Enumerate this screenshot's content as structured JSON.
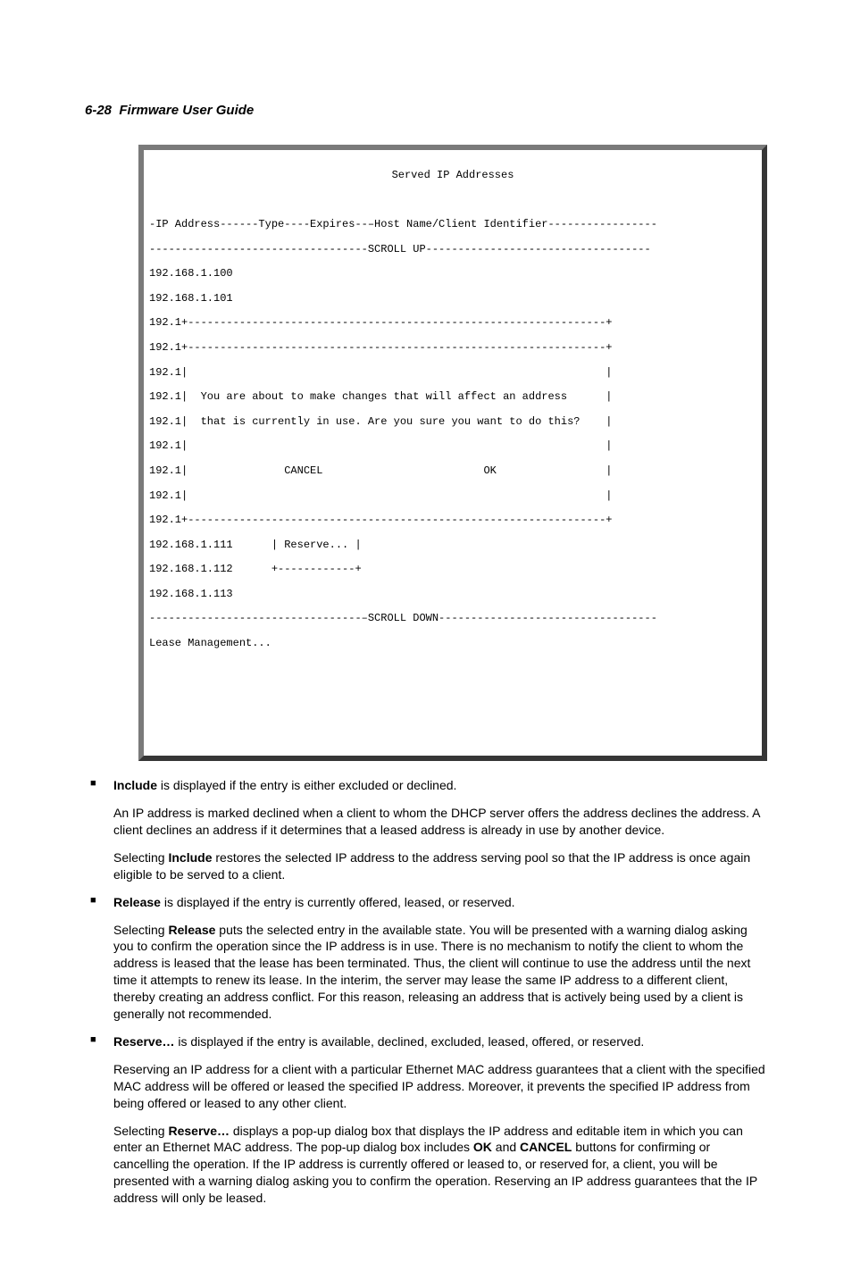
{
  "header": {
    "page_number": "6-28",
    "title": "Firmware User Guide"
  },
  "terminal": {
    "title": "Served IP Addresses",
    "columns_line": "-IP Address------Type----Expires--–Host Name/Client Identifier-----------------",
    "scroll_up_line": "----------------------------------SCROLL UP-----------------------------------",
    "ips_top": [
      "192.168.1.100",
      "192.168.1.101"
    ],
    "box_border_top1": "192.1+-----------------------------------------------------------------+",
    "box_border_top2": "192.1+-----------------------------------------------------------------+",
    "box_empty": "192.1|                                                                 |",
    "box_msg1": "192.1|  You are about to make changes that will affect an address      |",
    "box_msg2": "192.1|  that is currently in use. Are you sure you want to do this?    |",
    "box_empty2": "192.1|                                                                 |",
    "box_buttons": "192.1|               CANCEL                         OK                 |",
    "box_empty3": "192.1|                                                                 |",
    "box_border_bot": "192.1+-----------------------------------------------------------------+",
    "ip_reserve": "192.168.1.111      | Reserve... |",
    "ip_112": "192.168.1.112      +------------+",
    "ip_113": "192.168.1.113",
    "scroll_down_line": "---------------------------------–SCROLL DOWN----------------------------------",
    "lease_mgmt": "Lease Management..."
  },
  "bullets": [
    {
      "lead": "Include",
      "lead_rest": " is displayed if the entry is either excluded or declined.",
      "paras": [
        "An IP address is marked declined when a client to whom the DHCP server offers the address declines the address. A client declines an address if it determines that a leased address is already in use by another device.",
        {
          "pre": "Selecting ",
          "bold": "Include",
          "post": " restores the selected IP address to the address serving pool so that the IP address is once again eligible to be served to a client."
        }
      ]
    },
    {
      "lead": "Release",
      "lead_rest": " is displayed if the entry is currently offered, leased, or reserved.",
      "paras": [
        {
          "pre": "Selecting ",
          "bold": "Release",
          "post": " puts the selected entry in the available state. You will be presented with a warning dialog asking you to confirm the operation since the IP address is in use. There is no mechanism to notify the client to whom the address is leased that the lease has been terminated. Thus, the client will continue to use the address until the next time it attempts to renew its lease. In the interim, the server may lease the same IP address to a different client, thereby creating an address conflict. For this reason, releasing an address that is actively being used by a client is generally not recommended."
        }
      ]
    },
    {
      "lead": "Reserve…",
      "lead_rest": " is displayed if the entry is available, declined, excluded, leased, offered, or reserved.",
      "paras": [
        "Reserving an IP address for a client with a particular Ethernet MAC address guarantees that a client with the specified MAC address will be offered or leased the specified IP address. Moreover, it prevents the specified IP address from being offered or leased to any other client.",
        {
          "pre": "Selecting ",
          "bold": "Reserve…",
          "post": " displays a pop-up dialog box that displays the IP address and editable item in which you can enter an Ethernet MAC address. The pop-up dialog box includes ",
          "bold2": "OK",
          "mid": " and ",
          "bold3": "CANCEL",
          "post2": " buttons for confirming or cancelling the operation. If the IP address is currently offered or leased to, or reserved for, a client, you will be presented with a warning dialog asking you to confirm the operation. Reserving an IP address guarantees that the IP address will only be leased."
        }
      ]
    }
  ]
}
